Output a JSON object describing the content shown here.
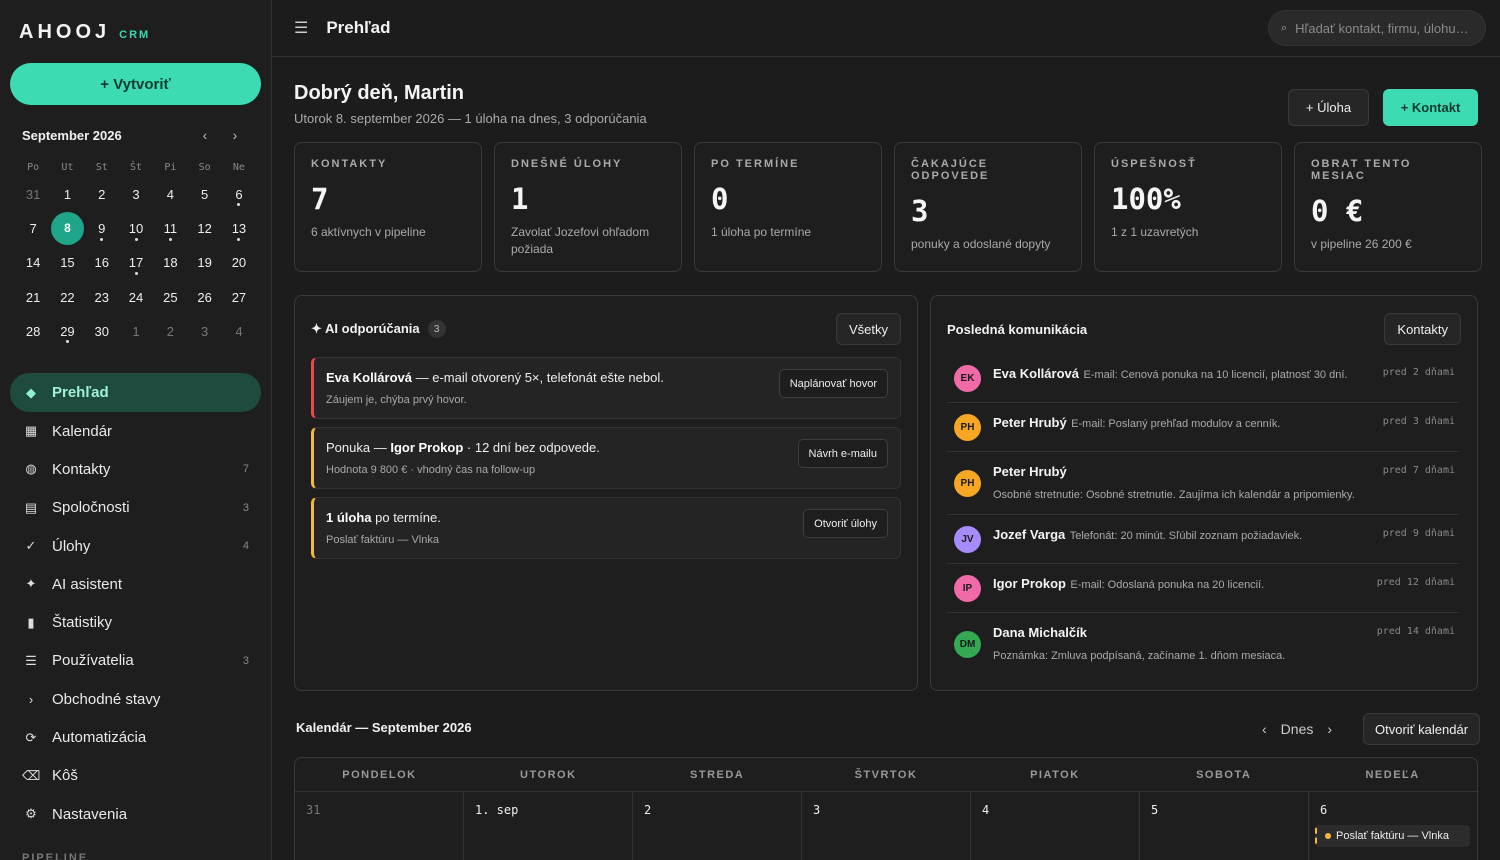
{
  "brand": {
    "name": "AHOOJ",
    "sub": "CRM"
  },
  "sidebar": {
    "create_label": "+ Vytvoriť",
    "mini_calendar": {
      "month": "September 2026",
      "prev": "‹",
      "next": "›",
      "weekdays": [
        "Po",
        "Ut",
        "St",
        "Št",
        "Pi",
        "So",
        "Ne"
      ],
      "days": [
        {
          "n": "31",
          "muted": true
        },
        {
          "n": "1"
        },
        {
          "n": "2"
        },
        {
          "n": "3"
        },
        {
          "n": "4"
        },
        {
          "n": "5"
        },
        {
          "n": "6",
          "dot": true
        },
        {
          "n": "7"
        },
        {
          "n": "8",
          "today": true
        },
        {
          "n": "9",
          "dot": true
        },
        {
          "n": "10",
          "dot": true
        },
        {
          "n": "11",
          "dot": true
        },
        {
          "n": "12"
        },
        {
          "n": "13",
          "dot": true
        },
        {
          "n": "14"
        },
        {
          "n": "15"
        },
        {
          "n": "16"
        },
        {
          "n": "17",
          "dot": true
        },
        {
          "n": "18"
        },
        {
          "n": "19"
        },
        {
          "n": "20"
        },
        {
          "n": "21"
        },
        {
          "n": "22"
        },
        {
          "n": "23"
        },
        {
          "n": "24"
        },
        {
          "n": "25"
        },
        {
          "n": "26"
        },
        {
          "n": "27"
        },
        {
          "n": "28"
        },
        {
          "n": "29",
          "dot": true
        },
        {
          "n": "30"
        },
        {
          "n": "1",
          "muted": true
        },
        {
          "n": "2",
          "muted": true
        },
        {
          "n": "3",
          "muted": true
        },
        {
          "n": "4",
          "muted": true
        }
      ]
    },
    "nav": [
      {
        "icon": "◆",
        "icon_name": "overview-icon",
        "label": "Prehľad",
        "count": "",
        "active": true
      },
      {
        "icon": "▦",
        "icon_name": "calendar-icon",
        "label": "Kalendár",
        "count": ""
      },
      {
        "icon": "◍",
        "icon_name": "contacts-icon",
        "label": "Kontakty",
        "count": "7"
      },
      {
        "icon": "▤",
        "icon_name": "companies-icon",
        "label": "Spoločnosti",
        "count": "3"
      },
      {
        "icon": "✓",
        "icon_name": "tasks-icon",
        "label": "Úlohy",
        "count": "4"
      },
      {
        "icon": "✦",
        "icon_name": "ai-icon",
        "label": "AI asistent",
        "count": ""
      },
      {
        "icon": "▮",
        "icon_name": "stats-icon",
        "label": "Štatistiky",
        "count": ""
      },
      {
        "icon": "☰",
        "icon_name": "users-icon",
        "label": "Používatelia",
        "count": "3"
      },
      {
        "icon": "›",
        "icon_name": "deals-icon",
        "label": "Obchodné stavy",
        "count": ""
      },
      {
        "icon": "⟳",
        "icon_name": "automation-icon",
        "label": "Automatizácia",
        "count": ""
      },
      {
        "icon": "⌫",
        "icon_name": "trash-icon",
        "label": "Kôš",
        "count": ""
      },
      {
        "icon": "⚙",
        "icon_name": "gear-icon",
        "label": "Nastavenia",
        "count": ""
      }
    ],
    "pipeline_label": "PIPELINE"
  },
  "topbar": {
    "menu_icon": "☰",
    "title": "Prehľad",
    "search_icon": "⌕",
    "search_placeholder": "Hľadať kontakt, firmu, úlohu…"
  },
  "header": {
    "greeting": "Dobrý deň, Martin",
    "subline": "Utorok 8. september 2026 — 1 úloha na dnes, 3 odporúčania",
    "task_btn": "+ Úloha",
    "contact_btn": "+ Kontakt"
  },
  "stats": [
    {
      "key": "KONTAKTY",
      "value": "7",
      "sub": "6 aktívnych v pipeline"
    },
    {
      "key": "DNEŠNÉ ÚLOHY",
      "value": "1",
      "sub": "Zavolať Jozefovi ohľadom požiada"
    },
    {
      "key": "PO TERMÍNE",
      "value": "0",
      "sub": "1 úloha po termíne"
    },
    {
      "key": "ČAKAJÚCE ODPOVEDE",
      "value": "3",
      "sub": "ponuky a odoslané dopyty"
    },
    {
      "key": "ÚSPEŠNOSŤ",
      "value": "100%",
      "sub": "1 z 1 uzavretých"
    },
    {
      "key": "OBRAT TENTO MESIAC",
      "value": "0 €",
      "sub": "v pipeline 26 200 €"
    }
  ],
  "ai_panel": {
    "title": "✦ AI odporúčania",
    "count": "3",
    "all_btn": "Všetky",
    "items": [
      {
        "color": "red",
        "bold": "Eva Kollárová",
        "text": " — e-mail otvorený 5×, telefonát ešte nebol.",
        "pre": "",
        "sub": "Záujem je, chýba prvý hovor.",
        "btn": "Naplánovať hovor"
      },
      {
        "color": "yel",
        "pre": "Ponuka — ",
        "bold": "Igor Prokop",
        "text": " · 12 dní bez odpovede.",
        "sub": "Hodnota 9 800 € · vhodný čas na follow-up",
        "btn": "Návrh e-mailu"
      },
      {
        "color": "yel",
        "pre": "",
        "bold": "1 úloha",
        "text": " po termíne.",
        "sub": "Poslať faktúru — Vlnka",
        "btn": "Otvoriť úlohy"
      }
    ]
  },
  "comm_panel": {
    "title": "Posledná komunikácia",
    "btn": "Kontakty",
    "items": [
      {
        "initials": "EK",
        "color": "#f06aa8",
        "name": "Eva Kollárová",
        "text": "E-mail: Cenová ponuka na 10 licencií, platnosť 30 dní.",
        "time": "pred 2 dňami",
        "wrap": false
      },
      {
        "initials": "PH",
        "color": "#f5a623",
        "name": "Peter Hrubý",
        "text": "E-mail: Poslaný prehľad modulov a cenník.",
        "time": "pred 3 dňami",
        "wrap": false
      },
      {
        "initials": "PH",
        "color": "#f5a623",
        "name": "Peter Hrubý",
        "text": "Osobné stretnutie: Osobné stretnutie. Zaujíma ich kalendár a pripomienky.",
        "time": "pred 7 dňami",
        "wrap": true
      },
      {
        "initials": "JV",
        "color": "#a78bfa",
        "name": "Jozef Varga",
        "text": "Telefonát: 20 minút. Sľúbil zoznam požiadaviek.",
        "time": "pred 9 dňami",
        "wrap": false
      },
      {
        "initials": "IP",
        "color": "#f06aa8",
        "name": "Igor Prokop",
        "text": "E-mail: Odoslaná ponuka na 20 licencií.",
        "time": "pred 12 dňami",
        "wrap": false
      },
      {
        "initials": "DM",
        "color": "#34a853",
        "name": "Dana Michalčík",
        "text": "Poznámka: Zmluva podpísaná, začíname 1. dňom mesiaca.",
        "time": "pred 14 dňami",
        "wrap": true
      }
    ]
  },
  "calendar": {
    "title": "Kalendár — September 2026",
    "prev": "‹",
    "today": "Dnes",
    "next": "›",
    "open_btn": "Otvoriť kalendár",
    "weekdays": [
      "PONDELOK",
      "UTOROK",
      "STREDA",
      "ŠTVRTOK",
      "PIATOK",
      "SOBOTA",
      "NEDEĽA"
    ],
    "first_row": [
      {
        "label": "31",
        "muted": true
      },
      {
        "label": "1. sep"
      },
      {
        "label": "2"
      },
      {
        "label": "3"
      },
      {
        "label": "4"
      },
      {
        "label": "5"
      },
      {
        "label": "6",
        "event": "Poslať faktúru — Vlnka"
      }
    ]
  }
}
